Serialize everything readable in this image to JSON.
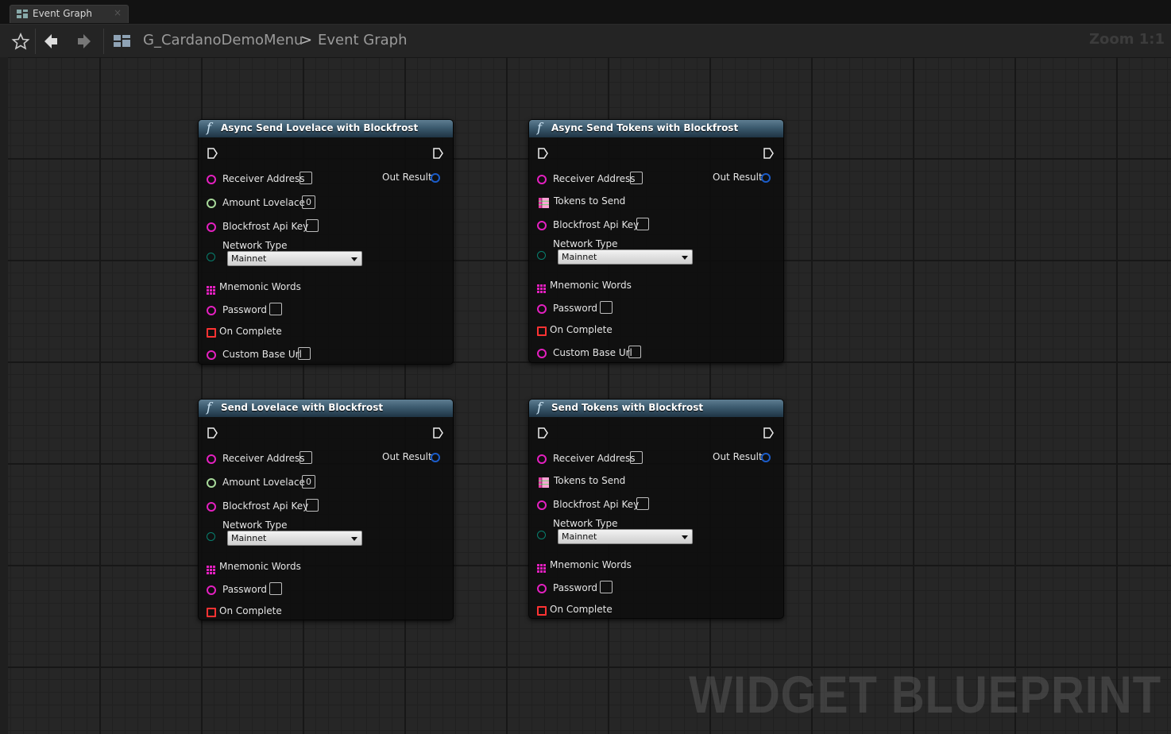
{
  "tab": {
    "label": "Event Graph",
    "close": "×"
  },
  "breadcrumb": {
    "blueprint": "G_CardanoDemoMenu",
    "separator": ">",
    "graph": "Event Graph",
    "zoom": "Zoom 1:1"
  },
  "watermark": "WIDGET BLUEPRINT",
  "nodes": [
    {
      "title": "Async Send Lovelace with Blockfrost",
      "fx": "f",
      "out_result": "Out Result",
      "receiver_address": "Receiver Address",
      "second_label": "Amount Lovelace",
      "second_value": "0",
      "api_key": "Blockfrost Api Key",
      "network_type": "Network Type",
      "network_value": "Mainnet",
      "mnemonic": "Mnemonic Words",
      "password": "Password",
      "on_complete": "On Complete",
      "custom_base_url": "Custom Base Url"
    },
    {
      "title": "Async Send Tokens with Blockfrost",
      "fx": "f",
      "out_result": "Out Result",
      "receiver_address": "Receiver Address",
      "second_label": "Tokens to Send",
      "api_key": "Blockfrost Api Key",
      "network_type": "Network Type",
      "network_value": "Mainnet",
      "mnemonic": "Mnemonic Words",
      "password": "Password",
      "on_complete": "On Complete",
      "custom_base_url": "Custom Base Url"
    },
    {
      "title": "Send Lovelace with Blockfrost",
      "fx": "f",
      "out_result": "Out Result",
      "receiver_address": "Receiver Address",
      "second_label": "Amount Lovelace",
      "second_value": "0",
      "api_key": "Blockfrost Api Key",
      "network_type": "Network Type",
      "network_value": "Mainnet",
      "mnemonic": "Mnemonic Words",
      "password": "Password",
      "on_complete": "On Complete"
    },
    {
      "title": "Send Tokens with Blockfrost",
      "fx": "f",
      "out_result": "Out Result",
      "receiver_address": "Receiver Address",
      "second_label": "Tokens to Send",
      "api_key": "Blockfrost Api Key",
      "network_type": "Network Type",
      "network_value": "Mainnet",
      "mnemonic": "Mnemonic Words",
      "password": "Password",
      "on_complete": "On Complete"
    }
  ],
  "colors": {
    "string_pin": "#e420c0",
    "float_pin": "#a7d99a",
    "byte_pin": "#08806f",
    "struct_out_pin": "#1b5cc9",
    "delegate_pin": "#ff3333",
    "array_pin": "#e420c0",
    "struct_array_pin": "#ffa2d6"
  }
}
